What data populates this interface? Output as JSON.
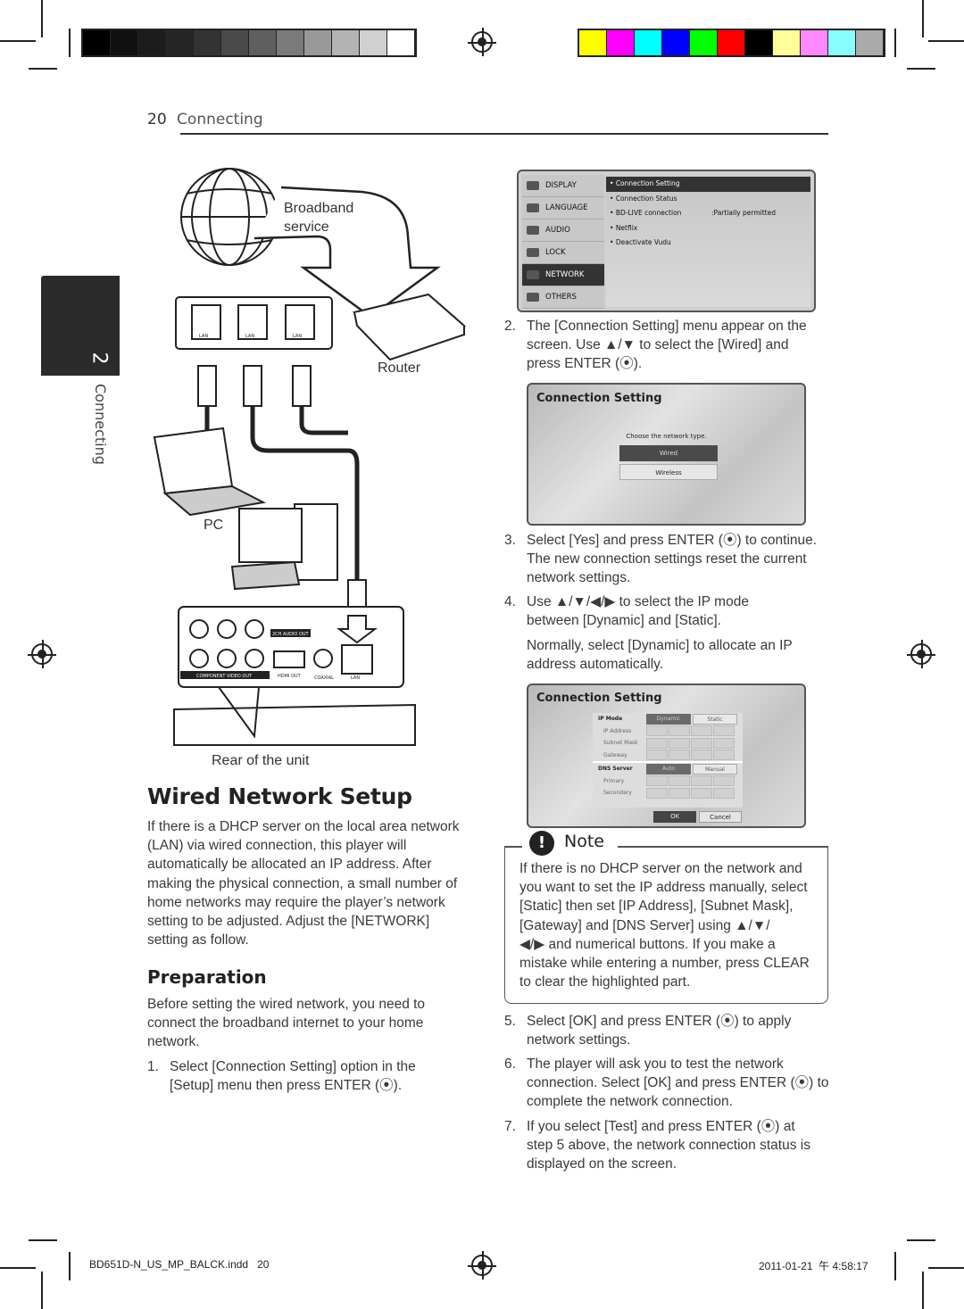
{
  "header": {
    "page_number": "20",
    "section": "Connecting"
  },
  "side_tab": {
    "chapter": "2",
    "label": "Connecting"
  },
  "print_marks": {
    "grayscale": [
      "#000000",
      "#111111",
      "#1c1c1c",
      "#262626",
      "#333333",
      "#494949",
      "#5f5f5f",
      "#7a7a7a",
      "#999999",
      "#b3b3b3",
      "#d0d0d0",
      "#ffffff"
    ],
    "colors": [
      "#ffff00",
      "#ff00ff",
      "#00ffff",
      "#0000ff",
      "#00ff00",
      "#ff0000",
      "#000000",
      "#ffff99",
      "#ff88ff",
      "#88ffff",
      "#aaaaaa"
    ]
  },
  "diagram": {
    "broadband": "Broadband",
    "service": "service",
    "router": "Router",
    "pc": "PC",
    "rear": "Rear of the unit",
    "port_labels": [
      "LAN",
      "LAN",
      "LAN"
    ],
    "unit_labels": {
      "audio_out": "2CH AUDIO OUT",
      "component": "COMPONENT VIDEO OUT",
      "hdmi": "HDMI OUT",
      "coaxial": "COAXIAL",
      "lan": "LAN"
    }
  },
  "left": {
    "title": "Wired Network Setup",
    "intro": [
      "If there is a DHCP server on the local area network",
      "(LAN) via wired connection, this player will",
      "automatically be allocated an IP address. After",
      "making the physical connection, a small number of",
      "home networks may require the player’s network",
      "setting to be adjusted. Adjust the [NETWORK]",
      "setting as follow."
    ],
    "prep_title": "Preparation",
    "prep": [
      "Before setting the wired network, you need to",
      "connect the broadband internet to your home",
      "network."
    ],
    "step1_num": "1.",
    "step1": [
      "Select [Connection Setting] option in the",
      "[Setup] menu then press ENTER (⦿)."
    ]
  },
  "setup_menu": {
    "categories": [
      "DISPLAY",
      "LANGUAGE",
      "AUDIO",
      "LOCK",
      "NETWORK",
      "OTHERS"
    ],
    "selected_category": "NETWORK",
    "items": [
      "Connection Setting",
      "Connection Status",
      "BD-LIVE connection",
      "Netflix",
      "Deactivate Vudu"
    ],
    "bd_live_value": ":Partially permitted"
  },
  "step2_num": "2.",
  "step2": [
    "The [Connection Setting] menu appear on the",
    "screen. Use ▲/▼ to select the [Wired] and",
    "press ENTER (⦿)."
  ],
  "conn_dialog": {
    "title": "Connection Setting",
    "prompt": "Choose the network type.",
    "options": [
      "Wired",
      "Wireless"
    ],
    "selected": "Wired"
  },
  "step3_num": "3.",
  "step3": [
    "Select [Yes] and press ENTER (⦿) to continue.",
    "The new connection settings reset the current",
    "network settings."
  ],
  "step4_num": "4.",
  "step4": [
    "Use ▲/▼/◀/▶ to select the IP mode",
    "between [Dynamic] and [Static]."
  ],
  "step4b": [
    "Normally, select [Dynamic] to allocate an IP",
    "address automatically."
  ],
  "ip_dialog": {
    "title": "Connection Setting",
    "ip_mode": "IP Mode",
    "modes": [
      "Dynamic",
      "Static"
    ],
    "fields": [
      "IP Address",
      "Subnet Mask",
      "Gateway"
    ],
    "dns": "DNS Server",
    "dns_modes": [
      "Auto",
      "Manual"
    ],
    "dns_fields": [
      "Primary",
      "Secondary"
    ],
    "ok": "OK",
    "cancel": "Cancel"
  },
  "note": {
    "icon": "!",
    "title": "Note",
    "lines": [
      "If there is no DHCP server on the network and",
      "you want to set the IP address manually, select",
      "[Static] then set [IP Address], [Subnet Mask],",
      "[Gateway] and [DNS Server] using ▲/▼/",
      "◀/▶ and numerical buttons. If you make a",
      "mistake while entering a number, press CLEAR",
      "to clear the highlighted part."
    ]
  },
  "step5_num": "5.",
  "step5": [
    "Select [OK] and press ENTER (⦿) to apply",
    "network settings."
  ],
  "step6_num": "6.",
  "step6": [
    "The player will ask you to test the network",
    "connection. Select [OK] and press ENTER (⦿) to",
    "complete the network connection."
  ],
  "step7_num": "7.",
  "step7": [
    "If you select [Test] and press ENTER (⦿) at",
    "step 5 above, the network connection status is",
    "displayed on the screen."
  ],
  "footer": {
    "file": "BD651D-N_US_MP_BALCK.indd   20",
    "date": "2011-01-21",
    "time": "午 4:58:17"
  }
}
